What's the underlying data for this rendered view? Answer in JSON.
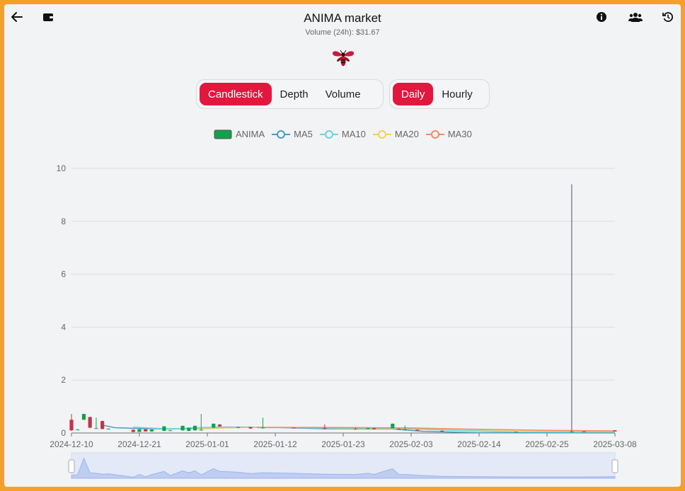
{
  "header": {
    "title": "ANIMA market",
    "subtitle": "Volume (24h): $31.67",
    "icons": [
      "back-arrow-icon",
      "wallet-icon",
      "info-icon",
      "users-icon",
      "history-icon"
    ]
  },
  "chart_tabs": [
    {
      "label": "Candlestick",
      "active": true
    },
    {
      "label": "Depth",
      "active": false
    },
    {
      "label": "Volume",
      "active": false
    }
  ],
  "interval_tabs": [
    {
      "label": "Daily",
      "active": true
    },
    {
      "label": "Hourly",
      "active": false
    }
  ],
  "colors": {
    "accent": "#e3173e",
    "up": "#14a04a",
    "down": "#c2344a",
    "ma5": "#4a9cc4",
    "ma10": "#6cd3d8",
    "ma20": "#f3d15a",
    "ma30": "#ef8c6a"
  },
  "legend": [
    {
      "name": "ANIMA",
      "color": "#14a04a",
      "type": "box"
    },
    {
      "name": "MA5",
      "color": "#4a9cc4",
      "type": "line"
    },
    {
      "name": "MA10",
      "color": "#6cd3d8",
      "type": "line"
    },
    {
      "name": "MA20",
      "color": "#f3d15a",
      "type": "line"
    },
    {
      "name": "MA30",
      "color": "#ef8c6a",
      "type": "line"
    }
  ],
  "chart_data": {
    "type": "candlestick",
    "ylim": [
      0,
      10
    ],
    "yticks": [
      0,
      2,
      4,
      6,
      8,
      10
    ],
    "xlim": [
      "2024-12-10",
      "2025-03-08"
    ],
    "xticks": [
      "2024-12-10",
      "2024-12-21",
      "2025-01-01",
      "2025-01-12",
      "2025-01-23",
      "2025-02-03",
      "2025-02-14",
      "2025-02-25",
      "2025-03-08"
    ],
    "grid": true,
    "candles": [
      {
        "date": "2024-12-10",
        "open": 0.5,
        "close": 0.1,
        "high": 0.72,
        "low": 0.08
      },
      {
        "date": "2024-12-11",
        "open": 0.13,
        "close": 0.13,
        "high": 0.15,
        "low": 0.12
      },
      {
        "date": "2024-12-12",
        "open": 0.5,
        "close": 0.72,
        "high": 0.72,
        "low": 0.5
      },
      {
        "date": "2024-12-13",
        "open": 0.6,
        "close": 0.2,
        "high": 0.62,
        "low": 0.18
      },
      {
        "date": "2024-12-14",
        "open": 0.18,
        "close": 0.18,
        "high": 0.58,
        "low": 0.16
      },
      {
        "date": "2024-12-15",
        "open": 0.45,
        "close": 0.15,
        "high": 0.47,
        "low": 0.14
      },
      {
        "date": "2024-12-16",
        "open": 0.16,
        "close": 0.16,
        "high": 0.17,
        "low": 0.15
      },
      {
        "date": "2024-12-20",
        "open": 0.12,
        "close": 0.04,
        "high": 0.14,
        "low": 0.03
      },
      {
        "date": "2024-12-21",
        "open": 0.04,
        "close": 0.14,
        "high": 0.15,
        "low": 0.04
      },
      {
        "date": "2024-12-22",
        "open": 0.14,
        "close": 0.06,
        "high": 0.15,
        "low": 0.05
      },
      {
        "date": "2024-12-23",
        "open": 0.06,
        "close": 0.13,
        "high": 0.14,
        "low": 0.05
      },
      {
        "date": "2024-12-25",
        "open": 0.08,
        "close": 0.25,
        "high": 0.26,
        "low": 0.07
      },
      {
        "date": "2024-12-26",
        "open": 0.1,
        "close": 0.1,
        "high": 0.11,
        "low": 0.09
      },
      {
        "date": "2024-12-28",
        "open": 0.1,
        "close": 0.27,
        "high": 0.28,
        "low": 0.09
      },
      {
        "date": "2024-12-29",
        "open": 0.08,
        "close": 0.2,
        "high": 0.21,
        "low": 0.07
      },
      {
        "date": "2024-12-30",
        "open": 0.1,
        "close": 0.27,
        "high": 0.28,
        "low": 0.09
      },
      {
        "date": "2024-12-31",
        "open": 0.12,
        "close": 0.12,
        "high": 0.72,
        "low": 0.1
      },
      {
        "date": "2025-01-02",
        "open": 0.2,
        "close": 0.35,
        "high": 0.36,
        "low": 0.19
      },
      {
        "date": "2025-01-03",
        "open": 0.32,
        "close": 0.25,
        "high": 0.33,
        "low": 0.24
      },
      {
        "date": "2025-01-06",
        "open": 0.22,
        "close": 0.22,
        "high": 0.23,
        "low": 0.21
      },
      {
        "date": "2025-01-08",
        "open": 0.22,
        "close": 0.17,
        "high": 0.23,
        "low": 0.16
      },
      {
        "date": "2025-01-10",
        "open": 0.2,
        "close": 0.2,
        "high": 0.58,
        "low": 0.19
      },
      {
        "date": "2025-01-15",
        "open": 0.2,
        "close": 0.18,
        "high": 0.21,
        "low": 0.17
      },
      {
        "date": "2025-01-20",
        "open": 0.18,
        "close": 0.15,
        "high": 0.33,
        "low": 0.14
      },
      {
        "date": "2025-01-25",
        "open": 0.16,
        "close": 0.14,
        "high": 0.21,
        "low": 0.13
      },
      {
        "date": "2025-01-27",
        "open": 0.16,
        "close": 0.18,
        "high": 0.2,
        "low": 0.15
      },
      {
        "date": "2025-01-28",
        "open": 0.18,
        "close": 0.14,
        "high": 0.19,
        "low": 0.13
      },
      {
        "date": "2025-01-31",
        "open": 0.18,
        "close": 0.35,
        "high": 0.36,
        "low": 0.17
      },
      {
        "date": "2025-02-01",
        "open": 0.16,
        "close": 0.14,
        "high": 0.17,
        "low": 0.13
      },
      {
        "date": "2025-02-02",
        "open": 0.14,
        "close": 0.14,
        "high": 0.28,
        "low": 0.13
      },
      {
        "date": "2025-02-04",
        "open": 0.12,
        "close": 0.11,
        "high": 0.13,
        "low": 0.1
      },
      {
        "date": "2025-02-08",
        "open": 0.08,
        "close": 0.07,
        "high": 0.09,
        "low": 0.06
      },
      {
        "date": "2025-02-20",
        "open": 0.05,
        "close": 0.05,
        "high": 0.06,
        "low": 0.04
      },
      {
        "date": "2025-03-01",
        "open": 0.04,
        "close": 0.05,
        "high": 9.4,
        "low": 0.03
      },
      {
        "date": "2025-03-03",
        "open": 0.06,
        "close": 0.05,
        "high": 0.07,
        "low": 0.04
      },
      {
        "date": "2025-03-08",
        "open": 0.1,
        "close": 0.06,
        "high": 0.11,
        "low": 0.05
      }
    ],
    "series": [
      {
        "name": "MA5",
        "points": [
          [
            "2024-12-15",
            0.3
          ],
          [
            "2024-12-17",
            0.2
          ],
          [
            "2024-12-21",
            0.17
          ],
          [
            "2024-12-26",
            0.15
          ],
          [
            "2024-12-31",
            0.2
          ],
          [
            "2025-01-05",
            0.22
          ],
          [
            "2025-01-10",
            0.22
          ],
          [
            "2025-01-20",
            0.16
          ],
          [
            "2025-01-31",
            0.15
          ],
          [
            "2025-02-05",
            0.06
          ],
          [
            "2025-02-14",
            0.01
          ],
          [
            "2025-02-25",
            0.01
          ],
          [
            "2025-03-01",
            0.01
          ],
          [
            "2025-03-08",
            0.04
          ]
        ]
      },
      {
        "name": "MA10",
        "points": [
          [
            "2024-12-20",
            0.22
          ],
          [
            "2024-12-25",
            0.16
          ],
          [
            "2024-12-31",
            0.16
          ],
          [
            "2025-01-05",
            0.2
          ],
          [
            "2025-01-12",
            0.22
          ],
          [
            "2025-01-23",
            0.17
          ],
          [
            "2025-02-03",
            0.15
          ],
          [
            "2025-02-10",
            0.1
          ],
          [
            "2025-02-20",
            0.04
          ],
          [
            "2025-03-08",
            0.03
          ]
        ]
      },
      {
        "name": "MA20",
        "points": [
          [
            "2024-12-30",
            0.18
          ],
          [
            "2025-01-05",
            0.2
          ],
          [
            "2025-01-12",
            0.22
          ],
          [
            "2025-01-23",
            0.2
          ],
          [
            "2025-02-03",
            0.18
          ],
          [
            "2025-02-14",
            0.12
          ],
          [
            "2025-02-25",
            0.08
          ],
          [
            "2025-03-08",
            0.06
          ]
        ]
      },
      {
        "name": "MA30",
        "points": [
          [
            "2025-01-09",
            0.2
          ],
          [
            "2025-01-20",
            0.21
          ],
          [
            "2025-02-03",
            0.19
          ],
          [
            "2025-02-14",
            0.14
          ],
          [
            "2025-02-25",
            0.1
          ],
          [
            "2025-03-08",
            0.08
          ]
        ]
      }
    ]
  }
}
